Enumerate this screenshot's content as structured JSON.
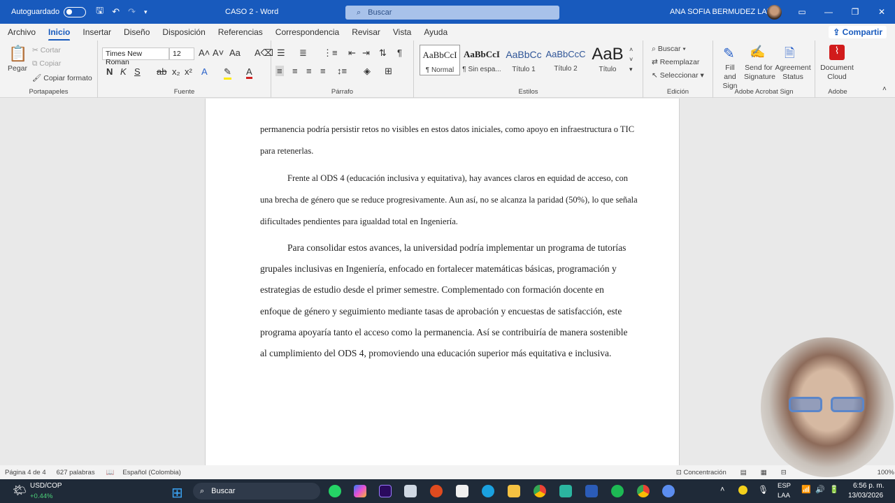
{
  "titlebar": {
    "autosave_label": "Autoguardado",
    "doc_title": "CASO 2  -  Word",
    "search_placeholder": "Buscar",
    "user_name": "ANA SOFIA BERMUDEZ LARA"
  },
  "tabs": [
    "Archivo",
    "Inicio",
    "Insertar",
    "Diseño",
    "Disposición",
    "Referencias",
    "Correspondencia",
    "Revisar",
    "Vista",
    "Ayuda"
  ],
  "share_label": "Compartir",
  "ribbon": {
    "clipboard": {
      "paste": "Pegar",
      "cut": "Cortar",
      "copy": "Copiar",
      "format_painter": "Copiar formato",
      "label": "Portapapeles"
    },
    "font": {
      "family": "Times New Roman",
      "size": "12",
      "label": "Fuente"
    },
    "paragraph": {
      "label": "Párrafo"
    },
    "styles": {
      "items": [
        {
          "sample": "AaBbCcI",
          "name": "¶ Normal"
        },
        {
          "sample": "AaBbCcI",
          "name": "¶ Sin espa..."
        },
        {
          "sample": "AaBbCc",
          "name": "Título 1"
        },
        {
          "sample": "AaBbCcC",
          "name": "Título 2"
        },
        {
          "sample": "AaB",
          "name": "Título"
        }
      ],
      "label": "Estilos"
    },
    "editing": {
      "find": "Buscar",
      "replace": "Reemplazar",
      "select": "Seleccionar",
      "label": "Edición"
    },
    "acrobat_sign": {
      "fill": "Fill and Sign",
      "send": "Send for Signature",
      "status": "Agreement Status",
      "label": "Adobe Acrobat Sign"
    },
    "adobe": {
      "cloud": "Document Cloud",
      "label": "Adobe"
    }
  },
  "document": {
    "p1": "permanencia podría persistir retos no visibles en estos datos iniciales, como apoyo en infraestructura o TIC para retenerlas.",
    "p2": "Frente al ODS 4 (educación inclusiva y equitativa), hay avances claros en equidad de acceso, con una brecha de género que se reduce progresivamente. Aun así, no se alcanza la paridad (50%), lo que señala dificultades pendientes para igualdad total en Ingeniería.",
    "p3": "Para consolidar estos avances, la universidad podría implementar un programa de tutorías grupales inclusivas en Ingeniería, enfocado en fortalecer matemáticas básicas, programación y estrategias de estudio desde el primer semestre. Complementado con formación docente en enfoque de género y seguimiento mediante tasas de aprobación y encuestas de satisfacción, este programa apoyaría tanto el acceso como la permanencia. Así se contribuiría de manera sostenible al cumplimiento del ODS 4, promoviendo una educación superior más equitativa e inclusiva."
  },
  "statusbar": {
    "page": "Página 4 de 4",
    "words": "627 palabras",
    "language": "Español (Colombia)",
    "focus": "Concentración",
    "zoom": "100%"
  },
  "taskbar": {
    "ticker": "USD/COP",
    "ticker_change": "+0.44%",
    "search": "Buscar",
    "lang1": "ESP",
    "lang2": "LAA",
    "time": "6:56 p. m.",
    "date": "13/03/2026"
  }
}
